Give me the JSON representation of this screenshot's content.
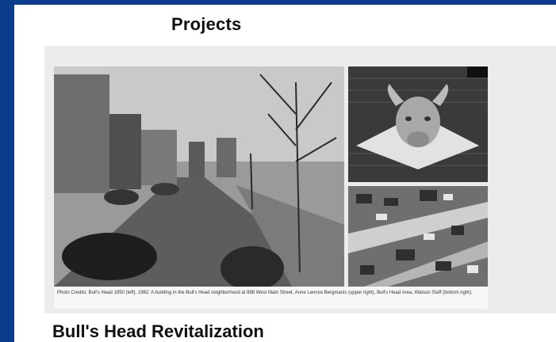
{
  "page": {
    "heading": "Projects",
    "caption": "Photo Credits: Bull's Head 1950 (left), 1982: A building in the Bull's Head neighborhood at 898 West Main Street, Anne Lennox Bergmanis (upper right), Bull's Head Area, Watson Staff (bottom right).",
    "title": "Bull's Head Revitalization"
  },
  "photos": {
    "left": "street-scene-photo",
    "upper_right": "bull-head-sculpture-photo",
    "bottom_right": "aerial-neighborhood-photo"
  },
  "colors": {
    "frame": "#0b3d8c",
    "panel": "#ececec",
    "text": "#111111"
  }
}
